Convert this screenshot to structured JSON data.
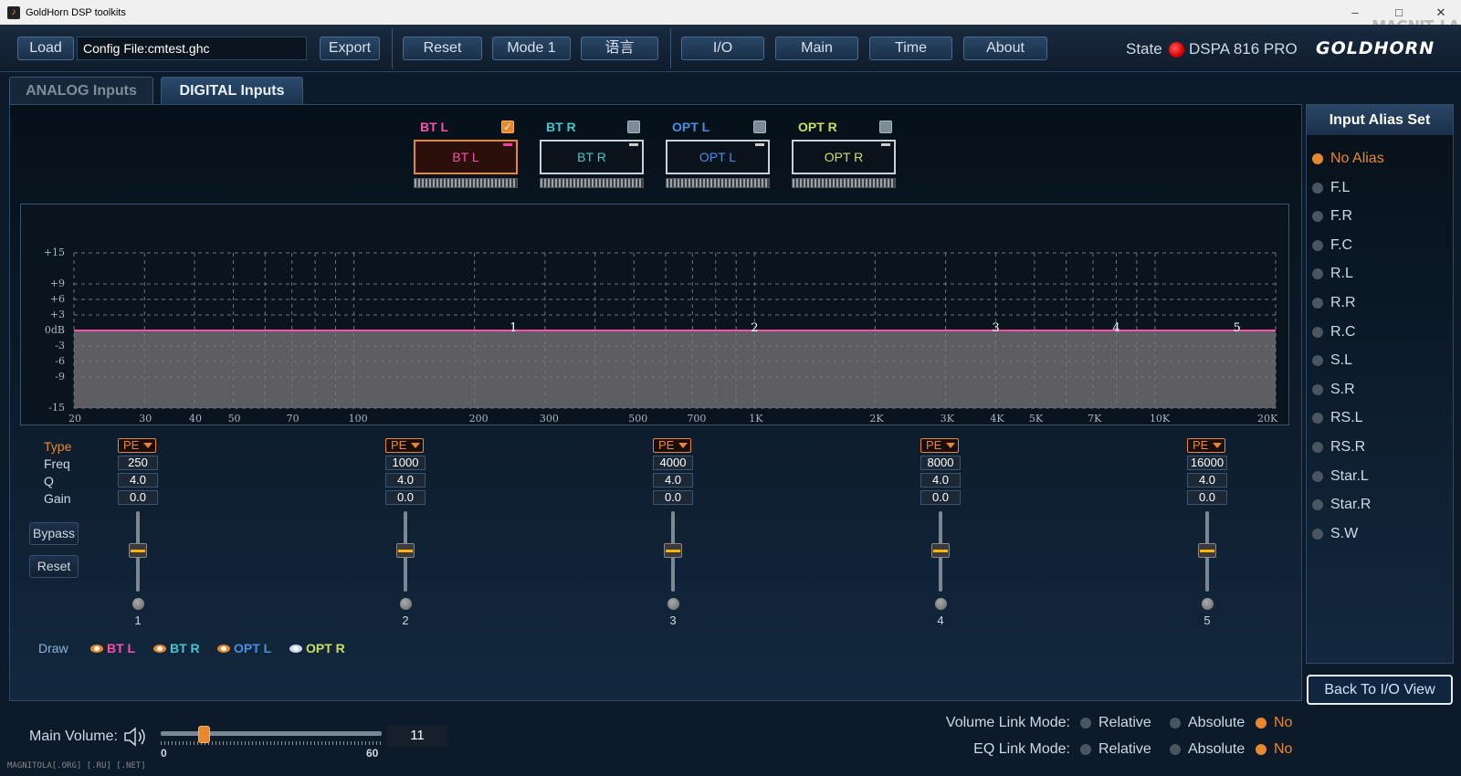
{
  "window": {
    "title": "GoldHorn DSP toolkits",
    "minimize": "–",
    "maximize": "□",
    "close": "✕",
    "watermark": "MAGNIT_LA"
  },
  "toolbar": {
    "load": "Load",
    "config_file": "Config File:cmtest.ghc",
    "export": "Export",
    "reset": "Reset",
    "mode": "Mode 1",
    "language": "语言",
    "io": "I/O",
    "main": "Main",
    "time": "Time",
    "about": "About",
    "state_label": "State",
    "state_color": "#e00000",
    "model": "DSPA 816 PRO",
    "logo": "GOLDHORN"
  },
  "tabs": [
    {
      "label": "ANALOG Inputs",
      "active": false
    },
    {
      "label": "DIGITAL Inputs",
      "active": true
    }
  ],
  "channels": [
    {
      "label": "BT L",
      "color": "#ff4fae",
      "checked": true,
      "selected": true
    },
    {
      "label": "BT R",
      "color": "#40c8d0",
      "checked": false,
      "selected": false
    },
    {
      "label": "OPT L",
      "color": "#4a8ee0",
      "checked": false,
      "selected": false
    },
    {
      "label": "OPT R",
      "color": "#c8e060",
      "checked": false,
      "selected": false
    }
  ],
  "graph": {
    "y_ticks": [
      "+15",
      "+9",
      "+6",
      "+3",
      "0dB",
      "-3",
      "-6",
      "-9",
      "-15"
    ],
    "x_ticks": [
      "20",
      "30",
      "40",
      "50",
      "70",
      "100",
      "200",
      "300",
      "500",
      "700",
      "1K",
      "2K",
      "3K",
      "4K",
      "5K",
      "7K",
      "10K",
      "20K"
    ],
    "band_labels": [
      "1",
      "2",
      "3",
      "4",
      "5"
    ]
  },
  "controls": {
    "type_label": "Type",
    "freq_label": "Freq",
    "q_label": "Q",
    "gain_label": "Gain",
    "bypass": "Bypass",
    "reset": "Reset"
  },
  "bands": [
    {
      "type": "PE",
      "freq": "250",
      "q": "4.0",
      "gain": "0.0",
      "num": "1"
    },
    {
      "type": "PE",
      "freq": "1000",
      "q": "4.0",
      "gain": "0.0",
      "num": "2"
    },
    {
      "type": "PE",
      "freq": "4000",
      "q": "4.0",
      "gain": "0.0",
      "num": "3"
    },
    {
      "type": "PE",
      "freq": "8000",
      "q": "4.0",
      "gain": "0.0",
      "num": "4"
    },
    {
      "type": "PE",
      "freq": "16000",
      "q": "4.0",
      "gain": "0.0",
      "num": "5"
    }
  ],
  "draw": {
    "label": "Draw",
    "items": [
      {
        "label": "BT L",
        "color": "#ff4fae"
      },
      {
        "label": "BT R",
        "color": "#40c8d0"
      },
      {
        "label": "OPT L",
        "color": "#4a8ee0"
      },
      {
        "label": "OPT R",
        "color": "#c8e060"
      }
    ]
  },
  "alias": {
    "title": "Input Alias Set",
    "items": [
      "No Alias",
      "F.L",
      "F.R",
      "F.C",
      "R.L",
      "R.R",
      "R.C",
      "S.L",
      "S.R",
      "RS.L",
      "RS.R",
      "Star.L",
      "Star.R",
      "S.W"
    ],
    "selected": 0
  },
  "back_button": "Back To I/O View",
  "volume": {
    "label": "Main Volume:",
    "min": "0",
    "max": "60",
    "value": "11"
  },
  "volume_link": {
    "label": "Volume Link Mode:",
    "options": [
      "Relative",
      "Absolute",
      "No"
    ],
    "selected": 2
  },
  "eq_link": {
    "label": "EQ Link Mode:",
    "options": [
      "Relative",
      "Absolute",
      "No"
    ],
    "selected": 2
  },
  "footer_watermark": "MAGNITOLA[.ORG] [.RU] [.NET]"
}
